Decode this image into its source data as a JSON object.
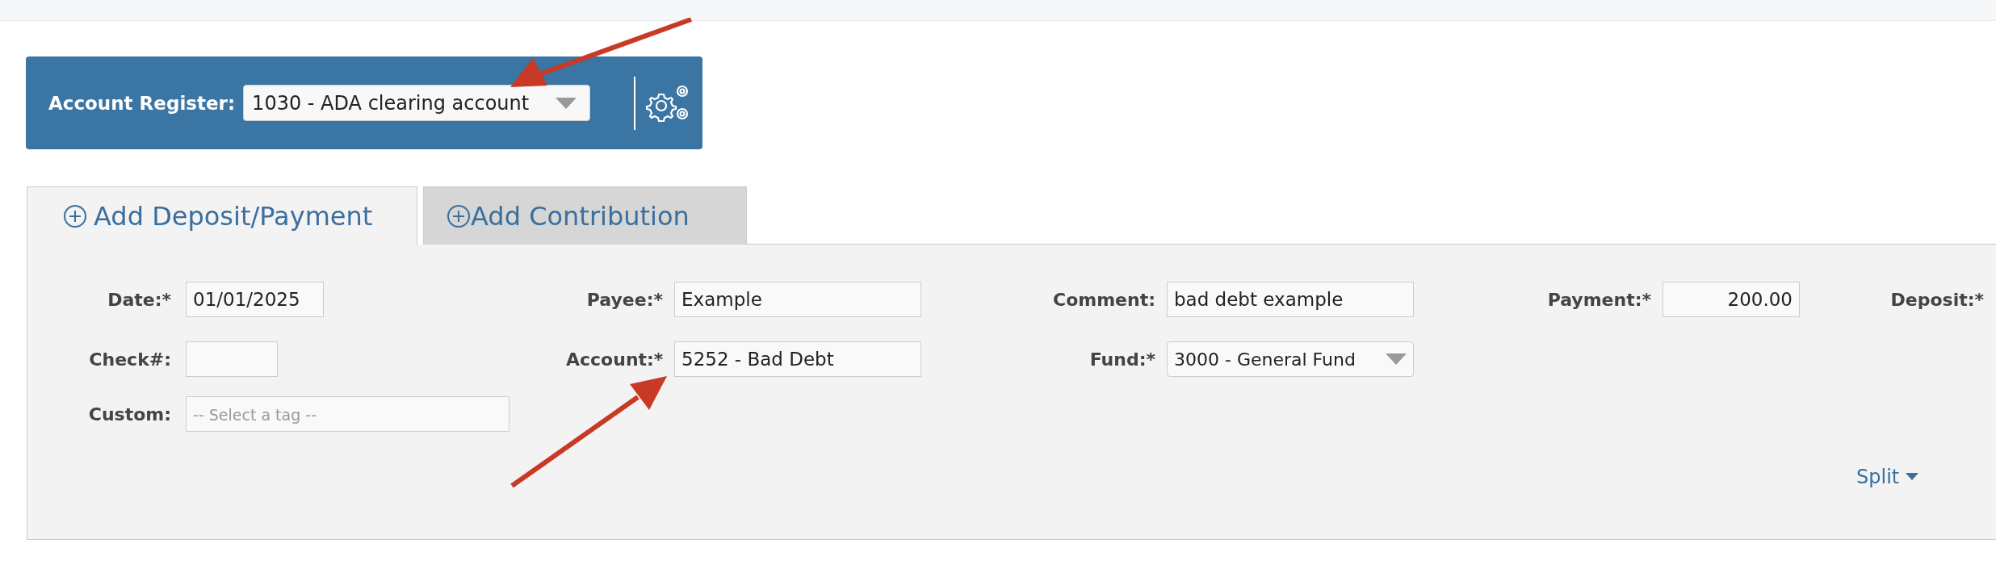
{
  "header": {
    "label": "Account Register:",
    "account": "1030 - ADA clearing account"
  },
  "tabs": [
    {
      "label": "Add Deposit/Payment",
      "selected": true
    },
    {
      "label": "Add Contribution",
      "selected": false
    }
  ],
  "rows": [
    [
      {
        "label": "Date:*",
        "kind": "date",
        "value": "01/01/2025"
      },
      {
        "label": "Payee:*",
        "kind": "text",
        "value": "Example"
      },
      {
        "label": "Comment:",
        "kind": "text",
        "value": "bad debt example"
      },
      {
        "label": "Payment:*",
        "kind": "amount",
        "value": "200.00"
      },
      {
        "label": "Deposit:*",
        "kind": "label"
      }
    ],
    [
      {
        "label": "Check#:",
        "kind": "number"
      },
      {
        "label": "Account:*",
        "kind": "text",
        "value": "5252 - Bad Debt"
      },
      {
        "label": "Fund:*",
        "kind": "select",
        "value": "3000 - General Fund"
      }
    ],
    [
      {
        "label": "Custom:",
        "kind": "tag",
        "placeholder": "-- Select a tag --"
      }
    ]
  ],
  "split_link": "Split"
}
